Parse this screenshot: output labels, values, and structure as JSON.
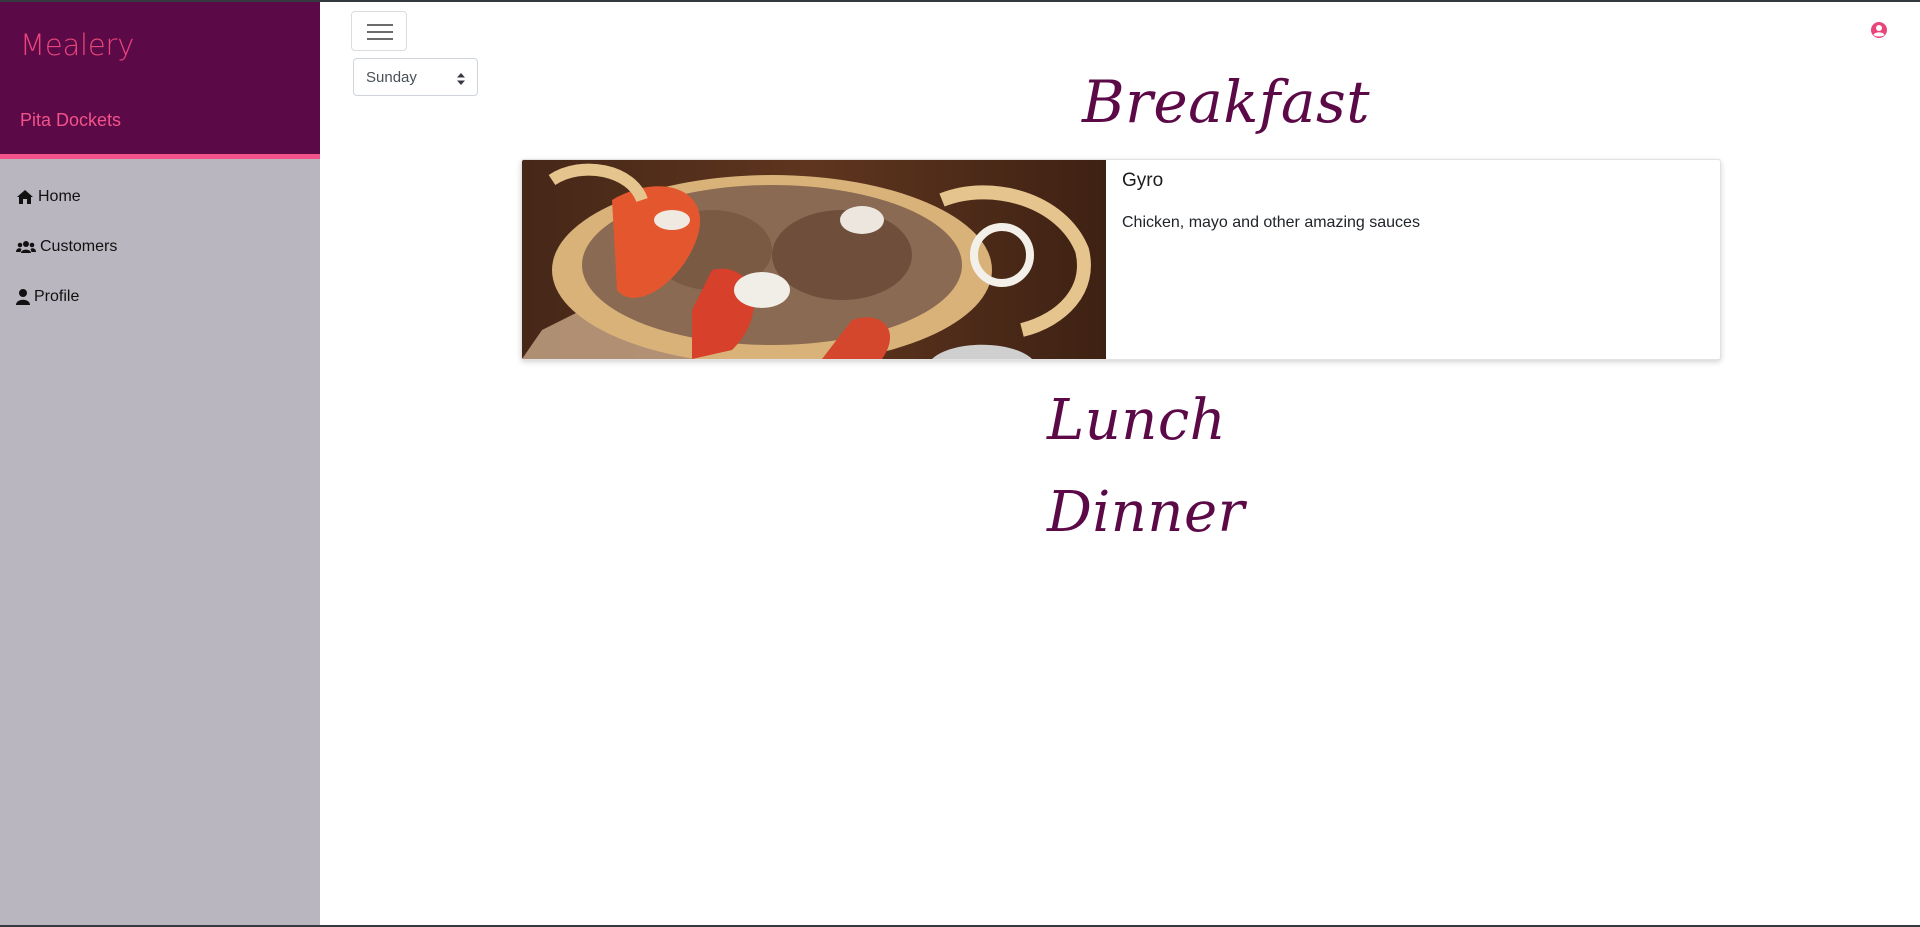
{
  "app": {
    "brand": "Mealery",
    "organization": "Pita Dockets"
  },
  "sidebar": {
    "items": [
      {
        "label": "Home",
        "icon": "home-icon"
      },
      {
        "label": "Customers",
        "icon": "users-icon"
      },
      {
        "label": "Profile",
        "icon": "user-icon"
      }
    ]
  },
  "header": {
    "menu_icon": "hamburger-menu-icon",
    "account_icon": "user-circle-icon"
  },
  "day_selector": {
    "selected": "Sunday"
  },
  "meals": {
    "breakfast_title": "Breakfast",
    "lunch_title": "Lunch",
    "dinner_title": "Dinner",
    "breakfast_items": [
      {
        "name": "Gyro",
        "description": "Chicken, mayo and other amazing sauces"
      }
    ]
  },
  "colors": {
    "sidebar_header": "#5c0a47",
    "accent": "#f2528a",
    "sidebar_body": "#bab6bf",
    "title": "#5c0a47"
  }
}
